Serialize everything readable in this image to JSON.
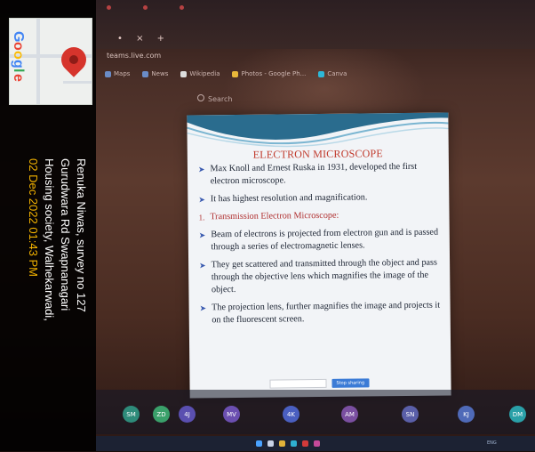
{
  "browser": {
    "tab_controls": "• × +",
    "url": "teams.live.com",
    "bookmarks": [
      "Maps",
      "News",
      "Wikipedia",
      "Photos - Google Ph...",
      "Canva"
    ],
    "search_placeholder": "Search"
  },
  "slide": {
    "title": "ELECTRON MICROSCOPE",
    "points": [
      {
        "bullet": "➤",
        "text": "Max Knoll and Ernest Ruska in 1931, developed the first electron microscope.",
        "style": "normal"
      },
      {
        "bullet": "➤",
        "text": "It has highest resolution and magnification.",
        "style": "normal"
      },
      {
        "bullet": "1.",
        "text": "Transmission Electron Microscope:",
        "style": "red"
      },
      {
        "bullet": "➤",
        "text": "Beam of electrons is projected from electron gun and is passed through a series of electromagnetic lenses.",
        "style": "normal"
      },
      {
        "bullet": "➤",
        "text": "They get scattered and transmitted through the object and pass through the objective lens which magnifies the image of the object.",
        "style": "normal"
      },
      {
        "bullet": "➤",
        "text": "The projection lens, further magnifies the image and projects it on the fluorescent screen.",
        "style": "normal"
      }
    ],
    "control_field": "",
    "control_button": "Stop sharing",
    "control_more": ""
  },
  "participants": [
    {
      "initials": "SM",
      "color": "#2e8b7a"
    },
    {
      "initials": "ZD",
      "color": "#3aa06a"
    },
    {
      "initials": "4J",
      "color": "#5a4fb0"
    },
    {
      "initials": "MV",
      "color": "#6b4fb0"
    },
    {
      "initials": "4K",
      "color": "#4a5fc0"
    },
    {
      "initials": "AM",
      "color": "#7a4fa0"
    },
    {
      "initials": "SN",
      "color": "#5a5fa8"
    },
    {
      "initials": "KJ",
      "color": "#4f6ab8"
    },
    {
      "initials": "DM",
      "color": "#2aa0a8"
    }
  ],
  "taskbar": {
    "tray": "ENG"
  },
  "geotag": {
    "logo": "Google",
    "lines": [
      "Renuka Niwas, survey no 127",
      "Gurudwara Rd Swapnanagari",
      "Housing society, Walhekarwadi,"
    ],
    "date": "02 Dec 2022 01:43 PM"
  }
}
